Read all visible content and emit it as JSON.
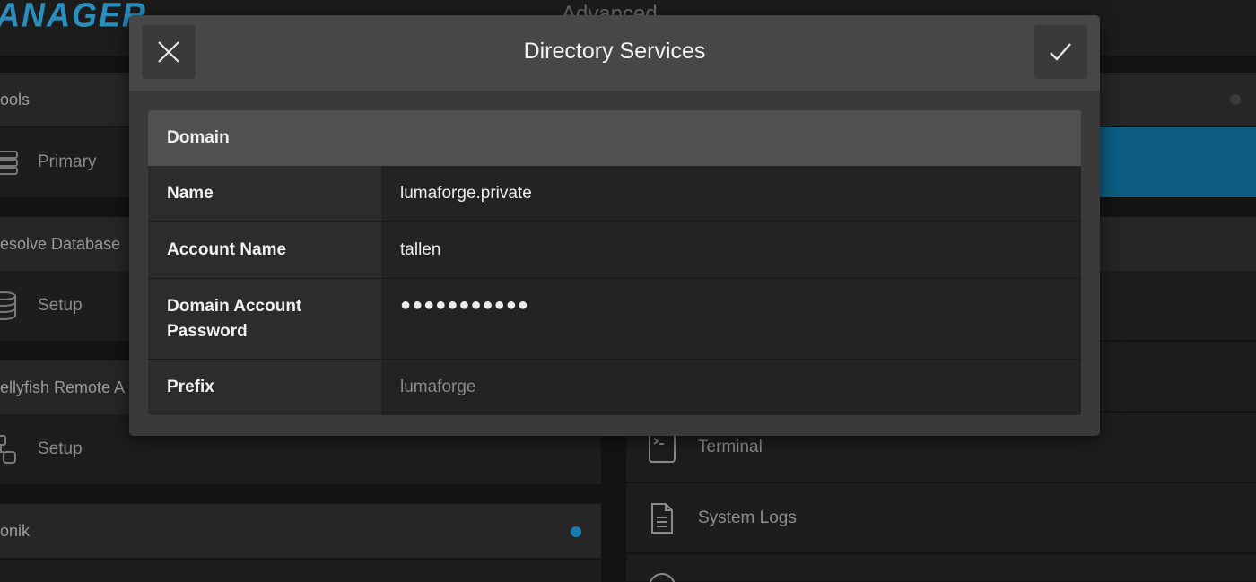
{
  "app": {
    "logo_text": "ANAGER",
    "page_heading": "Advanced"
  },
  "left_panel": {
    "sections": [
      {
        "title": "ools",
        "item_label": "Primary",
        "item_icon": "database-stack-icon"
      },
      {
        "title": "esolve Database",
        "item_label": "Setup",
        "item_icon": "database-icon"
      },
      {
        "title": "ellyfish Remote A",
        "item_label": "Setup",
        "item_icon": "remote-access-icon"
      },
      {
        "title": "onik",
        "status_color": "#1a7bb3"
      }
    ]
  },
  "right_panel": {
    "items": [
      {
        "label": "Terminal",
        "icon": "terminal-icon"
      },
      {
        "label": "System Logs",
        "icon": "document-icon"
      }
    ],
    "selected_color": "#0e5e84"
  },
  "modal": {
    "title": "Directory Services",
    "close_icon": "close-icon",
    "confirm_icon": "checkmark-icon",
    "section_title": "Domain",
    "fields": {
      "name": {
        "label": "Name",
        "value": "lumaforge.private"
      },
      "account_name": {
        "label": "Account Name",
        "value": "tallen"
      },
      "password": {
        "label_line1": "Domain Account",
        "label_line2": "Password",
        "value": "●●●●●●●●●●●"
      },
      "prefix": {
        "label": "Prefix",
        "placeholder": "lumaforge"
      }
    }
  }
}
